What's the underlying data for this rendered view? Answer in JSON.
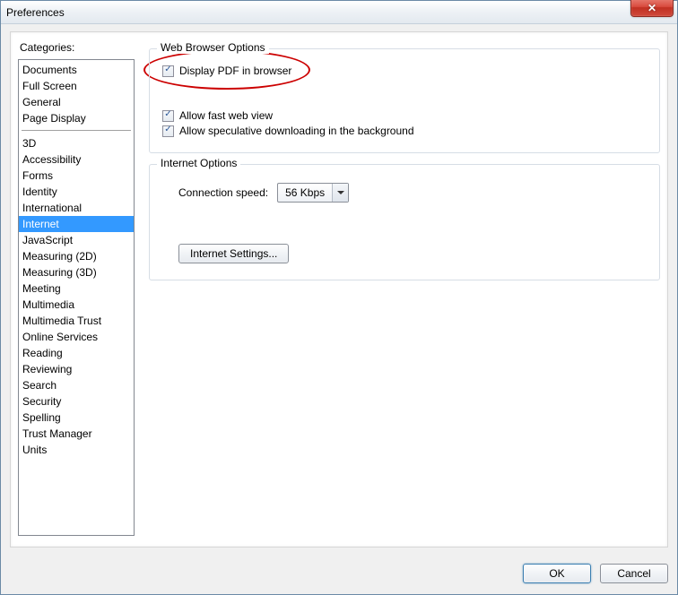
{
  "window": {
    "title": "Preferences"
  },
  "categories_label": "Categories:",
  "categories_top": [
    "Documents",
    "Full Screen",
    "General",
    "Page Display"
  ],
  "categories_bottom": [
    "3D",
    "Accessibility",
    "Forms",
    "Identity",
    "International",
    "Internet",
    "JavaScript",
    "Measuring (2D)",
    "Measuring (3D)",
    "Meeting",
    "Multimedia",
    "Multimedia Trust",
    "Online Services",
    "Reading",
    "Reviewing",
    "Search",
    "Security",
    "Spelling",
    "Trust Manager",
    "Units"
  ],
  "selected_category": "Internet",
  "group1": {
    "title": "Web Browser Options",
    "chk1": "Display PDF in browser",
    "chk2": "Allow fast web view",
    "chk3": "Allow speculative downloading in the background"
  },
  "group2": {
    "title": "Internet Options",
    "conn_label": "Connection speed:",
    "conn_value": "56 Kbps",
    "settings_btn": "Internet Settings..."
  },
  "footer": {
    "ok": "OK",
    "cancel": "Cancel"
  }
}
